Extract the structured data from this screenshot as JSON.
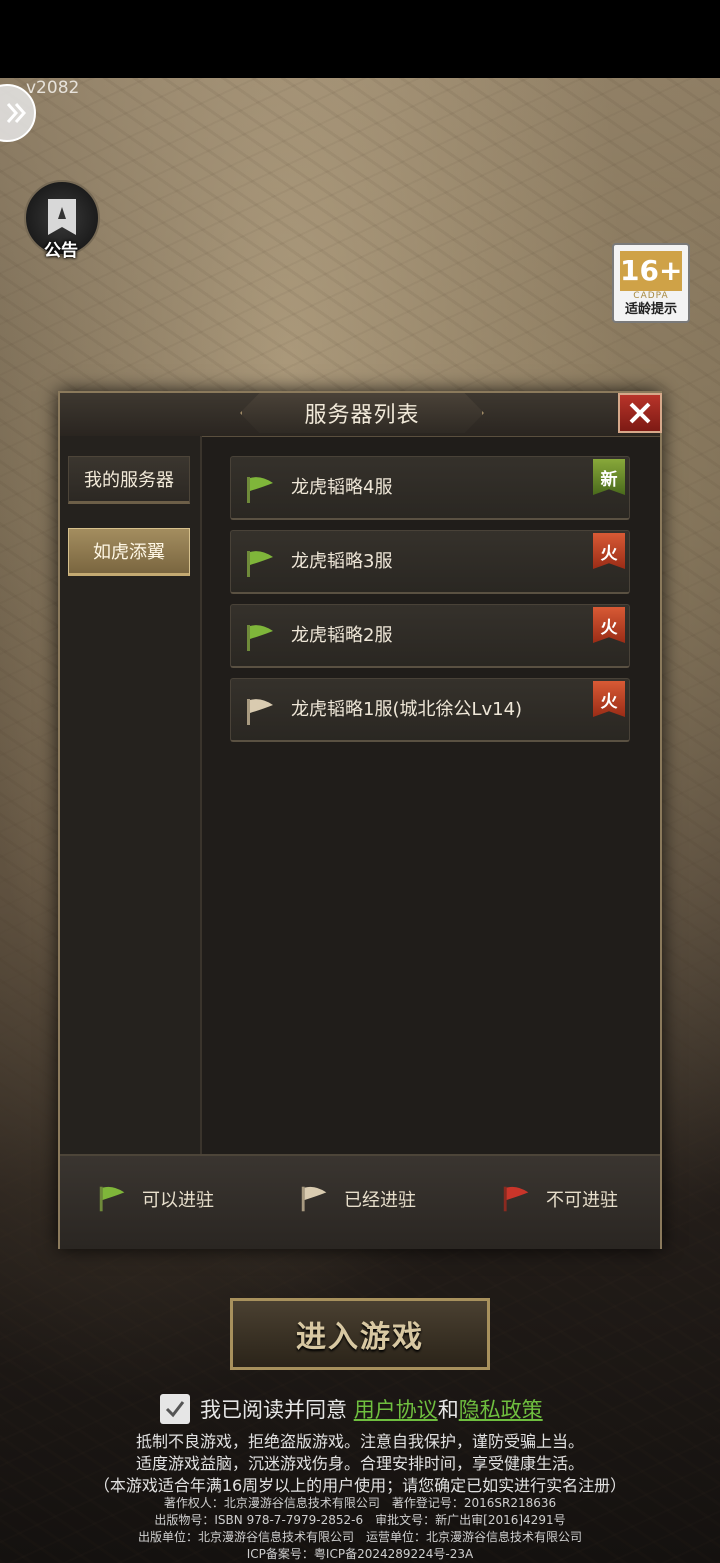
{
  "status_bar": {
    "version": "v2082"
  },
  "side_buttons": {
    "announce_label": "公告"
  },
  "age_rating": {
    "number": "16+",
    "org": "CADPA",
    "tip": "适龄提示"
  },
  "panel": {
    "title": "服务器列表",
    "tabs": [
      {
        "label": "我的服务器",
        "selected": false
      },
      {
        "label": "如虎添翼",
        "selected": true
      }
    ],
    "servers": [
      {
        "name": "龙虎韬略4服",
        "badge": "新",
        "flag_color": "#7fb63a"
      },
      {
        "name": "龙虎韬略3服",
        "badge": "火",
        "flag_color": "#7fb63a"
      },
      {
        "name": "龙虎韬略2服",
        "badge": "火",
        "flag_color": "#7fb63a"
      },
      {
        "name": "龙虎韬略1服(城北徐公Lv14)",
        "badge": "火",
        "flag_color": "#d9cbb0"
      }
    ],
    "legend": [
      {
        "label": "可以进驻",
        "color": "#7fb63a"
      },
      {
        "label": "已经进驻",
        "color": "#d9cbb0"
      },
      {
        "label": "不可进驻",
        "color": "#c9352a"
      }
    ]
  },
  "enter_button": {
    "label": "进入游戏"
  },
  "agreement": {
    "prefix": "我已阅读并同意",
    "user_agreement": "用户协议",
    "and": "和",
    "privacy_policy": "隐私政策"
  },
  "notices": {
    "line1": "抵制不良游戏，拒绝盗版游戏。注意自我保护，谨防受骗上当。",
    "line2": "适度游戏益脑，沉迷游戏伤身。合理安排时间，享受健康生活。",
    "line3": "（本游戏适合年满16周岁以上的用户使用；请您确定已如实进行实名注册）",
    "line4": "著作权人：北京漫游谷信息技术有限公司　著作登记号：2016SR218636",
    "line5": "出版物号：ISBN 978-7-7979-2852-6　审批文号：新广出审[2016]4291号",
    "line6": "出版单位：北京漫游谷信息技术有限公司　运营单位：北京漫游谷信息技术有限公司",
    "line7": "ICP备案号：粤ICP备2024289224号-23A"
  }
}
